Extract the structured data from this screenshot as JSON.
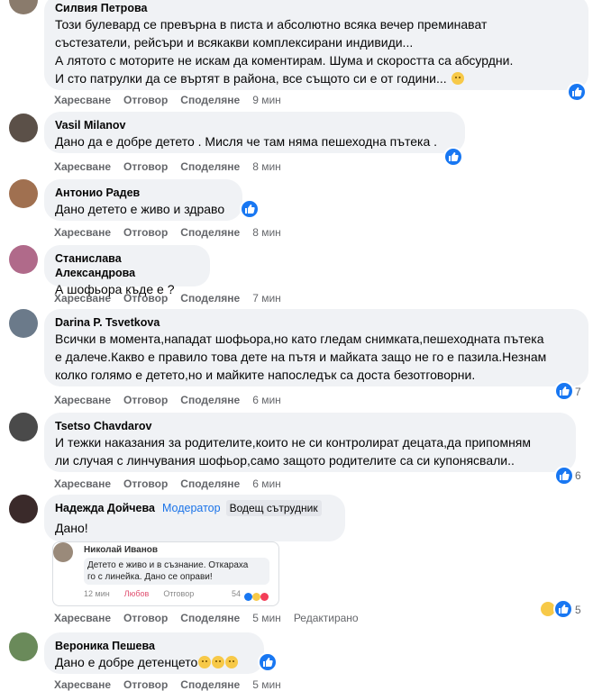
{
  "actions": {
    "like": "Харесване",
    "reply": "Отговор",
    "share": "Споделяне",
    "edited": "Редактирано"
  },
  "comments": [
    {
      "author": "Силвия Петрова",
      "text": "Този булевард се превърна в писта и абсолютно всяка вечер преминават\nсъстезатели, рейсъри и всякакви комплексирани индивиди...\nА лятото с моторите не искам да коментирам. Шума и скоростта са абсурдни.\nИ сто патрулки да се въртят в района, все същото си е от години...",
      "time": "9 мин"
    },
    {
      "author": "Vasil Milanov",
      "text": "Дано да е добре детето . Мисля че там няма пешеходна пътека .",
      "time": "8 мин"
    },
    {
      "author": "Антонио Радев",
      "text": "Дано детето е живо и здраво",
      "time": "8 мин"
    },
    {
      "author": "Станислава Александрова",
      "text": "А шофьора къде е ?",
      "time": "7 мин"
    },
    {
      "author": "Darina P. Tsvetkova",
      "text": "Всички в момента,нападат шофьора,но като гледам снимката,пешеходната пътека\nе далече.Какво е правило това дете на пътя и майката защо не го е пазила.Незнам\nколко голямо е детето,но и майките напоследък са доста безотговорни.",
      "time": "6 мин",
      "likes": "7"
    },
    {
      "author": "Tsetso Chavdarov",
      "text": "И тежки наказания за родителите,които не си контролират децата,да припомням\nли случая с линчувания шофьор,само защото родителите са си купонясвали..",
      "time": "6 мин",
      "likes": "6"
    },
    {
      "author": "Надежда Дойчева",
      "moderator": "Модератор",
      "badge": "Водещ сътрудник",
      "text": "Дано!",
      "time": "5 мин",
      "likes": "5"
    },
    {
      "author": "Вероника Пешева",
      "text": "Дано е добре детенцето",
      "time": "5 мин"
    }
  ],
  "quoted": {
    "author": "Николай Иванов",
    "text": "Детето е живо и в съзнание. Откараха\nго с линейка. Дано се оправи!",
    "time": "12 мин",
    "like": "Любов",
    "reply": "Отговор",
    "count": "54"
  }
}
